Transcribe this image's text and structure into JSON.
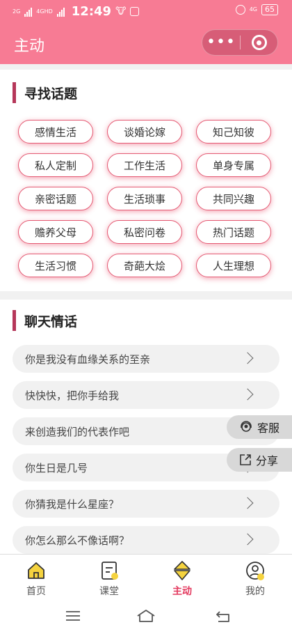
{
  "status": {
    "time": "12:49",
    "net1": "2G",
    "net2": "4GHD",
    "net3": "4G",
    "battery": "65"
  },
  "header": {
    "title": "主动",
    "menu_label": "•••"
  },
  "section_tags": {
    "title": "寻找话题",
    "tags": [
      "感情生活",
      "谈婚论嫁",
      "知己知彼",
      "私人定制",
      "工作生活",
      "单身专属",
      "亲密话题",
      "生活琐事",
      "共同兴趣",
      "赡养父母",
      "私密问卷",
      "热门话题",
      "生活习惯",
      "奇葩大烩",
      "人生理想"
    ]
  },
  "section_chat": {
    "title": "聊天情话",
    "items": [
      "你是我没有血缘关系的至亲",
      "快快快，把你手给我",
      "来创造我们的代表作吧",
      "你生日是几号",
      "你猜我是什么星座？",
      "你怎么那么不像话啊？"
    ]
  },
  "floating": {
    "service": "客服",
    "share": "分享"
  },
  "tabbar": {
    "items": [
      {
        "label": "首页",
        "icon": "home-icon"
      },
      {
        "label": "课堂",
        "icon": "notebook-icon"
      },
      {
        "label": "主动",
        "icon": "heart-active-icon"
      },
      {
        "label": "我的",
        "icon": "profile-icon"
      }
    ],
    "active": "主动"
  },
  "colors": {
    "brand": "#f77b94",
    "accent": "#e3395e",
    "tag_border": "#e45a73"
  }
}
